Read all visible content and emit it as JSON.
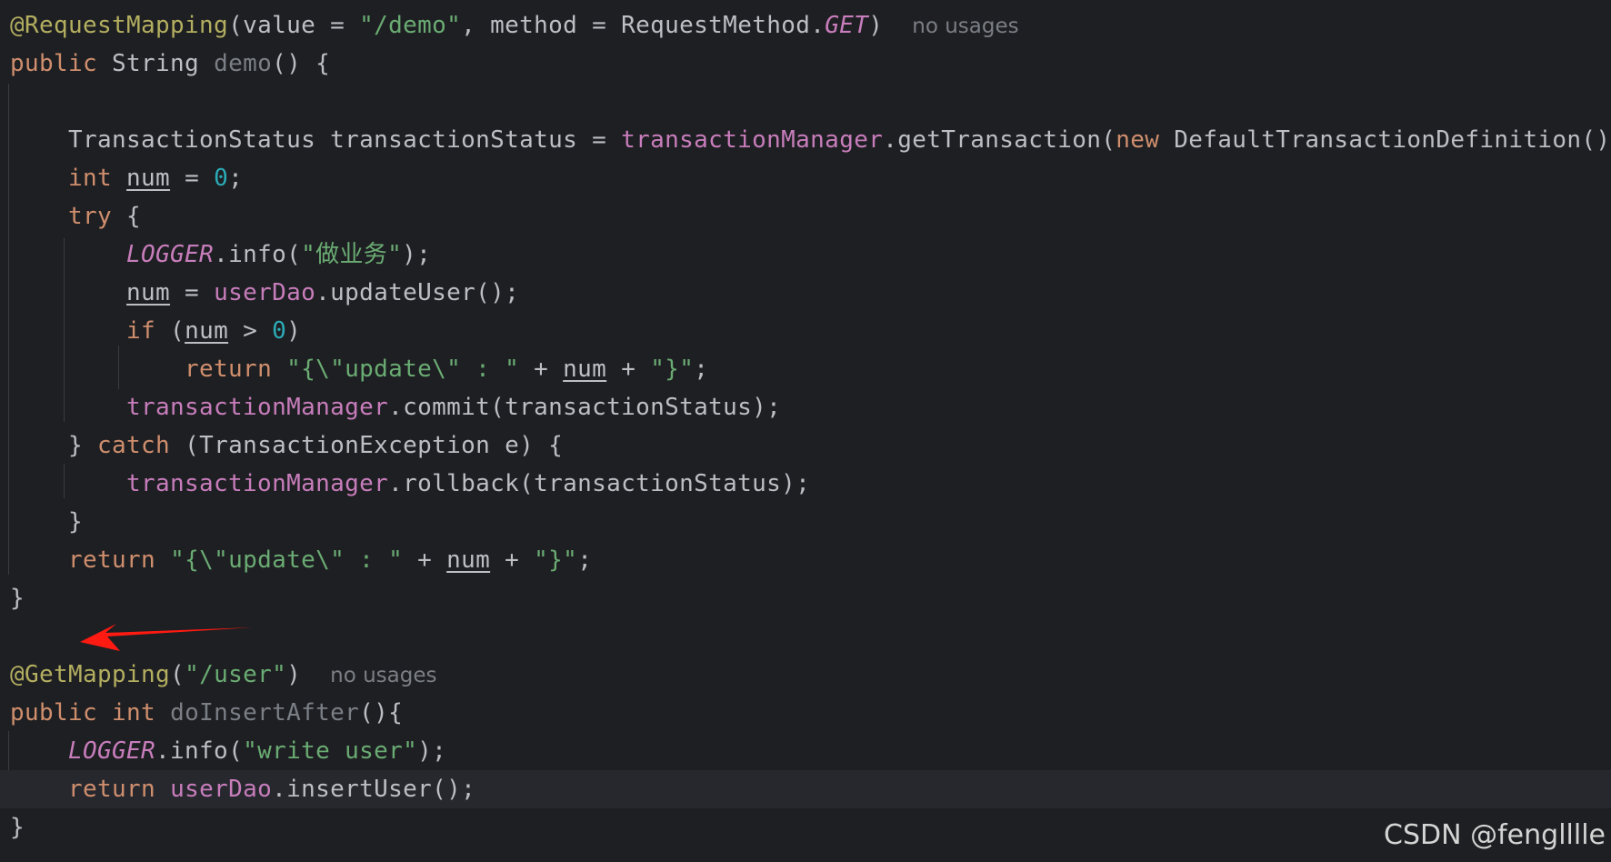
{
  "editor": {
    "language": "java",
    "colors": {
      "background": "#1e1f22",
      "annotation": "#b3ae60",
      "keyword": "#cf8e6d",
      "string": "#6aab73",
      "number": "#2aacb8",
      "field": "#c77dbb",
      "unused": "#7a7e85",
      "text": "#bcbec4",
      "arrow": "#ff1a12"
    },
    "lines": [
      {
        "tokens": [
          [
            "ann",
            "@RequestMapping"
          ],
          [
            "p",
            "(value = "
          ],
          [
            "str",
            "\"/demo\""
          ],
          [
            "p",
            ", method = RequestMethod."
          ],
          [
            "static",
            "GET"
          ],
          [
            "p",
            ")"
          ]
        ],
        "hint": "no usages"
      },
      {
        "tokens": [
          [
            "kw",
            "public"
          ],
          [
            "p",
            " String "
          ],
          [
            "unused",
            "demo"
          ],
          [
            "p",
            "() {"
          ]
        ]
      },
      {
        "tokens": []
      },
      {
        "tokens": [
          [
            "p",
            "    TransactionStatus transactionStatus = "
          ],
          [
            "field",
            "transactionManager"
          ],
          [
            "p",
            ".getTransaction("
          ],
          [
            "kw",
            "new"
          ],
          [
            "p",
            " DefaultTransactionDefinition());"
          ]
        ]
      },
      {
        "tokens": [
          [
            "p",
            "    "
          ],
          [
            "kw",
            "int"
          ],
          [
            "p",
            " "
          ],
          [
            "var",
            "num"
          ],
          [
            "p",
            " = "
          ],
          [
            "num",
            "0"
          ],
          [
            "p",
            ";"
          ]
        ]
      },
      {
        "tokens": [
          [
            "p",
            "    "
          ],
          [
            "kw",
            "try"
          ],
          [
            "p",
            " {"
          ]
        ]
      },
      {
        "tokens": [
          [
            "p",
            "        "
          ],
          [
            "static",
            "LOGGER"
          ],
          [
            "p",
            ".info("
          ],
          [
            "str",
            "\"做业务\""
          ],
          [
            "p",
            ");"
          ]
        ]
      },
      {
        "tokens": [
          [
            "p",
            "        "
          ],
          [
            "var",
            "num"
          ],
          [
            "p",
            " = "
          ],
          [
            "field",
            "userDao"
          ],
          [
            "p",
            ".updateUser();"
          ]
        ]
      },
      {
        "tokens": [
          [
            "p",
            "        "
          ],
          [
            "kw",
            "if"
          ],
          [
            "p",
            " ("
          ],
          [
            "var",
            "num"
          ],
          [
            "p",
            " > "
          ],
          [
            "num",
            "0"
          ],
          [
            "p",
            ")"
          ]
        ]
      },
      {
        "tokens": [
          [
            "p",
            "            "
          ],
          [
            "kw",
            "return"
          ],
          [
            "p",
            " "
          ],
          [
            "str",
            "\"{\\\"update\\\" : \""
          ],
          [
            "p",
            " + "
          ],
          [
            "var",
            "num"
          ],
          [
            "p",
            " + "
          ],
          [
            "str",
            "\"}\""
          ],
          [
            "p",
            ";"
          ]
        ]
      },
      {
        "tokens": [
          [
            "p",
            "        "
          ],
          [
            "field",
            "transactionManager"
          ],
          [
            "p",
            ".commit(transactionStatus);"
          ]
        ]
      },
      {
        "tokens": [
          [
            "p",
            "    } "
          ],
          [
            "kw",
            "catch"
          ],
          [
            "p",
            " (TransactionException e) {"
          ]
        ]
      },
      {
        "tokens": [
          [
            "p",
            "        "
          ],
          [
            "field",
            "transactionManager"
          ],
          [
            "p",
            ".rollback(transactionStatus);"
          ]
        ]
      },
      {
        "tokens": [
          [
            "p",
            "    }"
          ]
        ]
      },
      {
        "tokens": [
          [
            "p",
            "    "
          ],
          [
            "kw",
            "return"
          ],
          [
            "p",
            " "
          ],
          [
            "str",
            "\"{\\\"update\\\" : \""
          ],
          [
            "p",
            " + "
          ],
          [
            "var",
            "num"
          ],
          [
            "p",
            " + "
          ],
          [
            "str",
            "\"}\""
          ],
          [
            "p",
            ";"
          ]
        ]
      },
      {
        "tokens": [
          [
            "p",
            "}"
          ]
        ]
      },
      {
        "tokens": []
      },
      {
        "tokens": [
          [
            "ann",
            "@GetMapping"
          ],
          [
            "p",
            "("
          ],
          [
            "str",
            "\"/user\""
          ],
          [
            "p",
            ")"
          ]
        ],
        "hint": "no usages"
      },
      {
        "tokens": [
          [
            "kw",
            "public"
          ],
          [
            "p",
            " "
          ],
          [
            "kw",
            "int"
          ],
          [
            "p",
            " "
          ],
          [
            "unused",
            "doInsertAfter"
          ],
          [
            "p",
            "(){"
          ]
        ]
      },
      {
        "tokens": [
          [
            "p",
            "    "
          ],
          [
            "static",
            "LOGGER"
          ],
          [
            "p",
            ".info("
          ],
          [
            "str",
            "\"write user\""
          ],
          [
            "p",
            ");"
          ]
        ]
      },
      {
        "tokens": [
          [
            "p",
            "    "
          ],
          [
            "kw",
            "return"
          ],
          [
            "p",
            " "
          ],
          [
            "field",
            "userDao"
          ],
          [
            "p",
            ".insertUser();"
          ]
        ],
        "current": true
      },
      {
        "tokens": [
          [
            "p",
            "}"
          ]
        ]
      }
    ],
    "arrow": {
      "icon": "red-arrow-icon",
      "points_to": "@GetMapping"
    }
  },
  "watermark": {
    "text": "CSDN @fenglllle"
  }
}
